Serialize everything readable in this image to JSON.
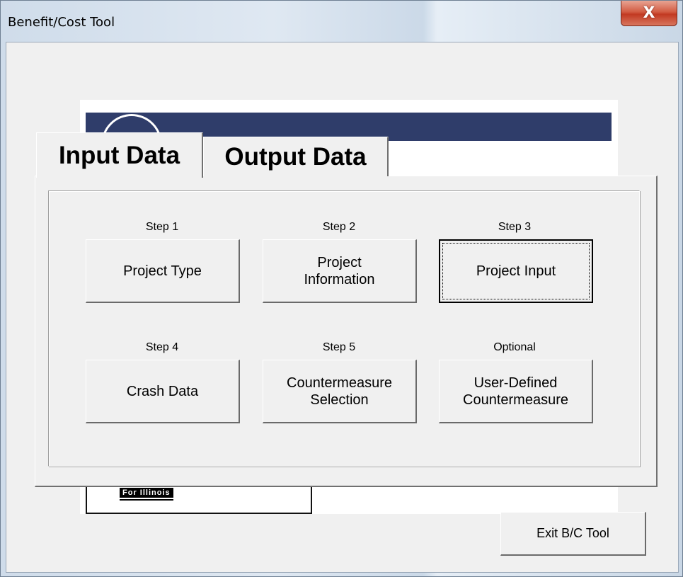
{
  "window": {
    "title": "Benefit/Cost Tool",
    "close_glyph": "X"
  },
  "background": {
    "logo_text": "For Illinois"
  },
  "tabs": [
    {
      "label": "Input Data",
      "selected": true
    },
    {
      "label": "Output Data",
      "selected": false
    }
  ],
  "steps": [
    {
      "label": "Step 1",
      "button": "Project Type"
    },
    {
      "label": "Step 2",
      "button": "Project\nInformation"
    },
    {
      "label": "Step 3",
      "button": "Project Input"
    },
    {
      "label": "Step 4",
      "button": "Crash Data"
    },
    {
      "label": "Step 5",
      "button": "Countermeasure\nSelection"
    },
    {
      "label": "Optional",
      "button": "User-Defined\nCountermeasure"
    }
  ],
  "exit_button": "Exit B/C Tool",
  "colors": {
    "banner_band": "#2f3d6a",
    "close_button": "#c23a22",
    "control_face": "#f0f0f0"
  },
  "icons": {
    "close": "close-icon"
  }
}
